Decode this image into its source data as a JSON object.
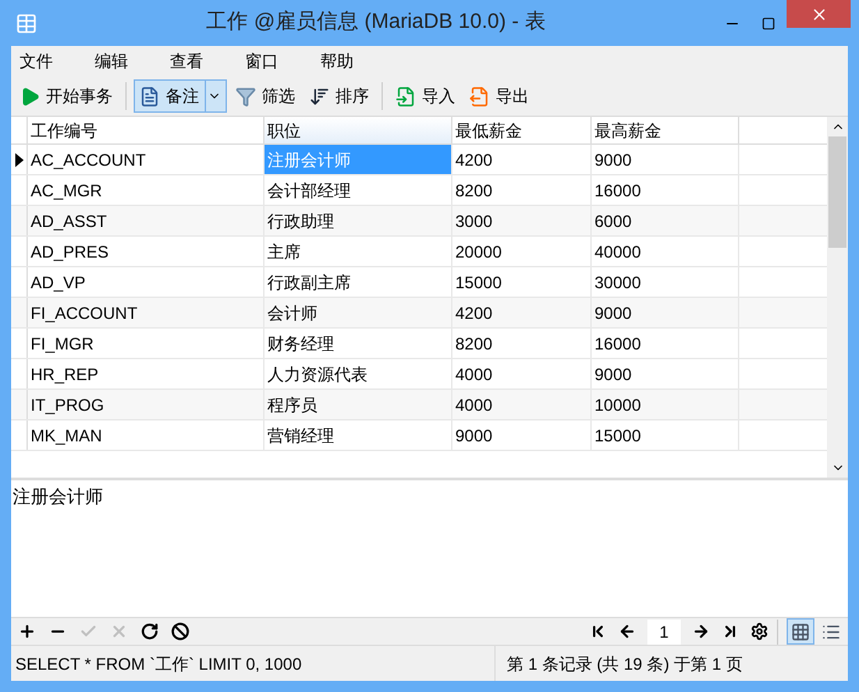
{
  "window": {
    "title": "工作 @雇员信息 (MariaDB 10.0) - 表"
  },
  "menu": [
    "文件",
    "编辑",
    "查看",
    "窗口",
    "帮助"
  ],
  "toolbar": [
    {
      "kind": "transaction",
      "label": "开始事务",
      "selected": false
    },
    {
      "kind": "memo",
      "label": "备注",
      "selected": true
    },
    {
      "kind": "filter",
      "label": "筛选",
      "selected": false
    },
    {
      "kind": "sort",
      "label": "排序",
      "selected": false
    },
    {
      "kind": "import",
      "label": "导入",
      "selected": false
    },
    {
      "kind": "export",
      "label": "导出",
      "selected": false
    }
  ],
  "table": {
    "columns": [
      {
        "label": "工作编号",
        "selected": false
      },
      {
        "label": "职位",
        "selected": true
      },
      {
        "label": "最低薪金",
        "selected": false
      },
      {
        "label": "最高薪金",
        "selected": false
      }
    ],
    "rows": [
      {
        "selected": true,
        "cells": [
          "AC_ACCOUNT",
          "注册会计师",
          "4200",
          "9000"
        ]
      },
      {
        "selected": false,
        "cells": [
          "AC_MGR",
          "会计部经理",
          "8200",
          "16000"
        ]
      },
      {
        "selected": false,
        "cells": [
          "AD_ASST",
          "行政助理",
          "3000",
          "6000"
        ]
      },
      {
        "selected": false,
        "cells": [
          "AD_PRES",
          "主席",
          "20000",
          "40000"
        ]
      },
      {
        "selected": false,
        "cells": [
          "AD_VP",
          "行政副主席",
          "15000",
          "30000"
        ]
      },
      {
        "selected": false,
        "cells": [
          "FI_ACCOUNT",
          "会计师",
          "4200",
          "9000"
        ]
      },
      {
        "selected": false,
        "cells": [
          "FI_MGR",
          "财务经理",
          "8200",
          "16000"
        ]
      },
      {
        "selected": false,
        "cells": [
          "HR_REP",
          "人力资源代表",
          "4000",
          "9000"
        ]
      },
      {
        "selected": false,
        "cells": [
          "IT_PROG",
          "程序员",
          "4000",
          "10000"
        ]
      },
      {
        "selected": false,
        "cells": [
          "MK_MAN",
          "营销经理",
          "9000",
          "15000"
        ]
      }
    ]
  },
  "memo": {
    "value": "注册会计师"
  },
  "record_tools": [
    {
      "kind": "add",
      "disabled": false
    },
    {
      "kind": "delete",
      "disabled": false
    },
    {
      "kind": "apply",
      "disabled": true
    },
    {
      "kind": "cancel",
      "disabled": true
    },
    {
      "kind": "refresh",
      "disabled": false
    },
    {
      "kind": "stop",
      "disabled": false
    }
  ],
  "pager": {
    "page": "1"
  },
  "views": [
    {
      "kind": "grid",
      "selected": true
    },
    {
      "kind": "form",
      "selected": false
    }
  ],
  "status_bar": {
    "query": "SELECT * FROM `工作` LIMIT 0, 1000",
    "records": "第 1 条记录 (共 19 条) 于第 1 页"
  }
}
